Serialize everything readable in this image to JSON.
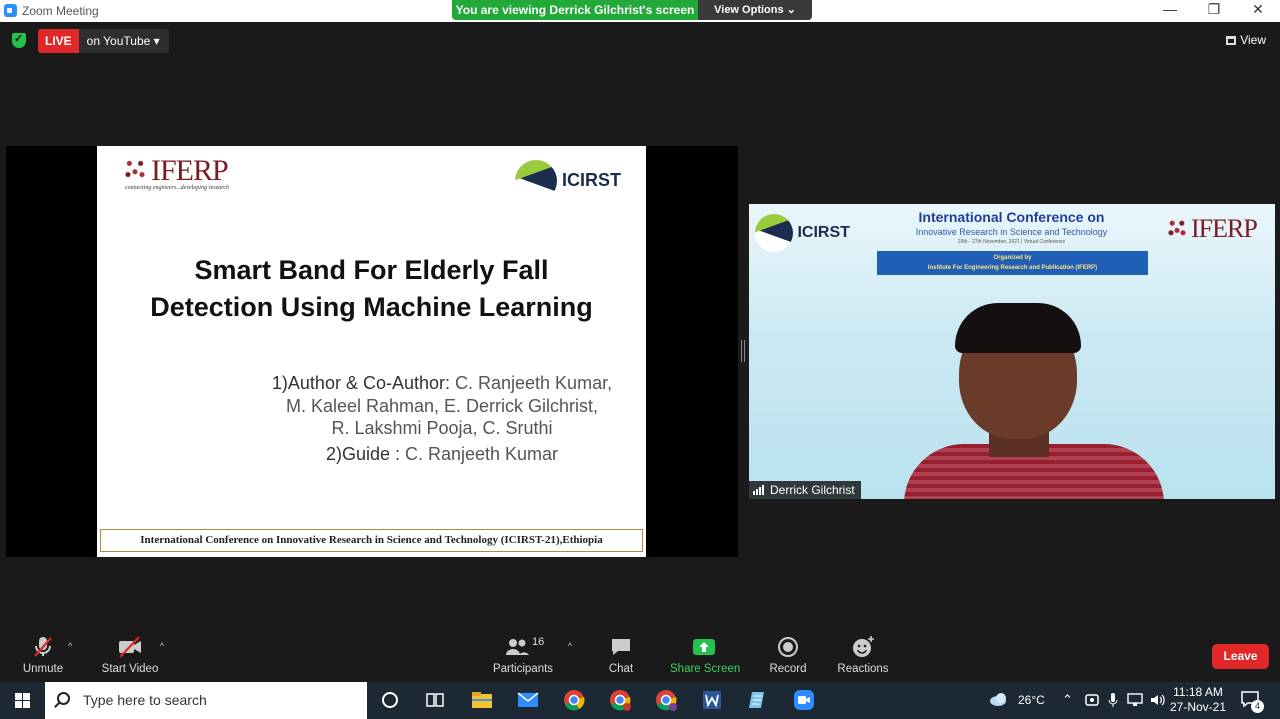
{
  "window": {
    "title": "Zoom Meeting",
    "minimize": "—",
    "restore": "❐",
    "close": "✕"
  },
  "banner": {
    "message": "You are viewing Derrick Gilchrist's screen",
    "view_options": "View Options ⌄"
  },
  "live": {
    "badge": "LIVE",
    "destination": "on YouTube ▾"
  },
  "view_button": {
    "label": "View"
  },
  "slide": {
    "iferp_logo": "IFERP",
    "iferp_tagline": "connecting engineers...developing research",
    "icirst_logo": "ICIRST",
    "title_line1": "Smart Band For Elderly Fall",
    "title_line2": "Detection Using Machine Learning",
    "authors_label": "1)Author & Co-Author:",
    "authors_line1": " C. Ranjeeth Kumar,",
    "authors_line2": "M. Kaleel Rahman, E. Derrick Gilchrist,",
    "authors_line3": "R. Lakshmi Pooja, C. Sruthi",
    "guide_label": "2)Guide :",
    "guide_name": " C. Ranjeeth Kumar",
    "footer": "International Conference on Innovative Research in Science and Technology (ICIRST-21),Ethiopia"
  },
  "video": {
    "participant_name": "Derrick Gilchrist",
    "bg_title": "International Conference on",
    "bg_subtitle": "Innovative Research in Science and Technology",
    "bg_dates": "26th - 27th November, 2021 | Virtual Conference",
    "bg_org_label": "Organized by",
    "bg_org_name": "Institute For Engineering Research and Publication (IFERP)",
    "bg_icirst": "ICIRST",
    "bg_iferp": "IFERP"
  },
  "toolbar": {
    "unmute": "Unmute",
    "start_video": "Start Video",
    "participants": "Participants",
    "participants_count": "16",
    "chat": "Chat",
    "share_screen": "Share Screen",
    "record": "Record",
    "reactions": "Reactions",
    "leave": "Leave",
    "caret": "^"
  },
  "taskbar": {
    "search_placeholder": "Type here to search",
    "temperature": "26°C",
    "time": "11:18 AM",
    "date": "27-Nov-21",
    "notifications": "4"
  },
  "colors": {
    "accent_green": "#23a83a",
    "live_red": "#e02828",
    "leave_red": "#e02828",
    "zoom_blue": "#2d8cff"
  }
}
